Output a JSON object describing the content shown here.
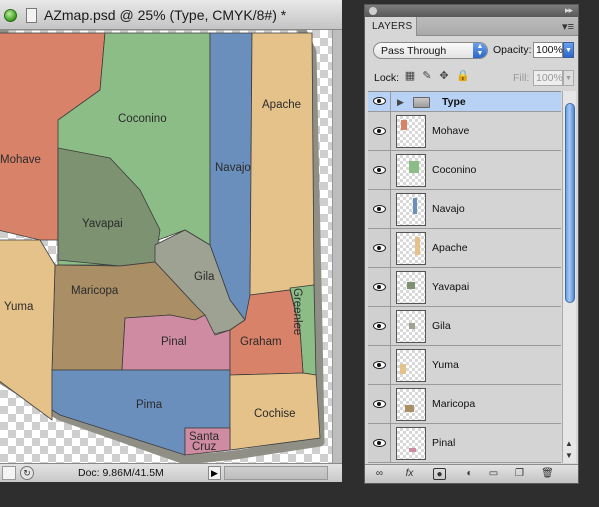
{
  "document": {
    "title": "AZmap.psd @ 25% (Type, CMYK/8#) *",
    "doc_info": "Doc: 9.86M/41.5M",
    "status_arrow": "▶"
  },
  "map": {
    "counties": [
      {
        "name": "Mohave",
        "color": "#d9826a"
      },
      {
        "name": "Coconino",
        "color": "#8dbd87"
      },
      {
        "name": "Navajo",
        "color": "#6a8fbd"
      },
      {
        "name": "Apache",
        "color": "#e5c289"
      },
      {
        "name": "Yavapai",
        "color": "#7c9270"
      },
      {
        "name": "Gila",
        "color": "#9ea293"
      },
      {
        "name": "Greenlee",
        "color": "#8dbd87"
      },
      {
        "name": "Maricopa",
        "color": "#a98e66"
      },
      {
        "name": "Yuma",
        "color": "#e5c289"
      },
      {
        "name": "Pinal",
        "color": "#cf8ba1"
      },
      {
        "name": "Graham",
        "color": "#d9826a"
      },
      {
        "name": "Pima",
        "color": "#6a8fbd"
      },
      {
        "name": "Cochise",
        "color": "#e5c289"
      },
      {
        "name": "Santa Cruz",
        "color": "#cf8ba1"
      }
    ],
    "border_color": "#8f8f86",
    "labels": {
      "mohave": "Mohave",
      "coconino": "Coconino",
      "navajo": "Navajo",
      "apache": "Apache",
      "yavapai": "Yavapai",
      "gila": "Gila",
      "greenlee": "Greenlee",
      "maricopa": "Maricopa",
      "yuma": "Yuma",
      "pinal": "Pinal",
      "graham": "Graham",
      "pima": "Pima",
      "cochise": "Cochise",
      "santa_cruz_1": "Santa",
      "santa_cruz_2": "Cruz"
    }
  },
  "layers_panel": {
    "tab_label": "LAYERS",
    "blend_mode": "Pass Through",
    "opacity_label": "Opacity:",
    "opacity_value": "100%",
    "lock_label": "Lock:",
    "fill_label": "Fill:",
    "fill_value": "100%",
    "group": {
      "name": "Type"
    },
    "layers": [
      {
        "name": "Mohave",
        "color": "#d9826a"
      },
      {
        "name": "Coconino",
        "color": "#8dbd87"
      },
      {
        "name": "Navajo",
        "color": "#6a8fbd"
      },
      {
        "name": "Apache",
        "color": "#e5c289"
      },
      {
        "name": "Yavapai",
        "color": "#7c9270"
      },
      {
        "name": "Gila",
        "color": "#9ea293"
      },
      {
        "name": "Yuma",
        "color": "#e5c289"
      },
      {
        "name": "Maricopa",
        "color": "#a98e66"
      },
      {
        "name": "Pinal",
        "color": "#cf8ba1"
      }
    ],
    "bottom_icons": [
      "link-icon",
      "fx-icon",
      "layer-mask-icon",
      "adjustment-icon",
      "new-group-icon",
      "new-layer-icon",
      "trash-icon"
    ]
  }
}
